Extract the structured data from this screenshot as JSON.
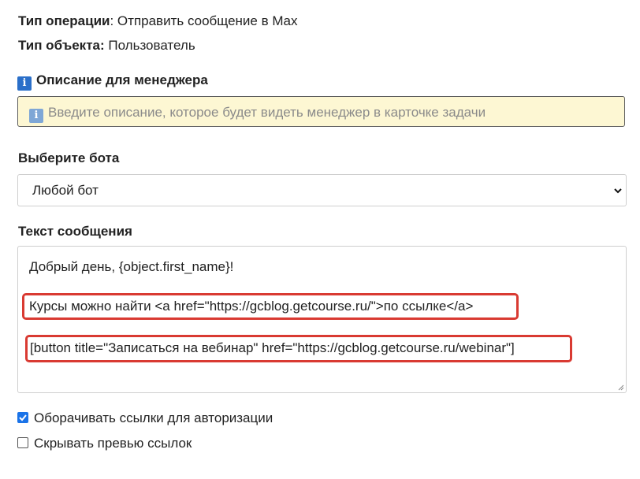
{
  "header": {
    "operation_label": "Тип операции",
    "operation_value": ": Отправить сообщение в Max",
    "object_label": "Тип объекта:",
    "object_value": " Пользователь"
  },
  "description": {
    "title": "Описание для менеджера",
    "placeholder": "Введите описание, которое будет видеть менеджер в карточке задачи"
  },
  "bot": {
    "label": "Выберите бота",
    "selected": "Любой бот"
  },
  "message": {
    "label": "Текст сообщения",
    "lines": [
      "Добрый день, {object.first_name}!",
      "Курсы можно найти <a href=\"https://gcblog.getcourse.ru/\">по ссылке</a>",
      "[button title=\"Записаться на вебинар\" href=\"https://gcblog.getcourse.ru/webinar\"]"
    ]
  },
  "options": {
    "wrap_links": {
      "label": "Оборачивать ссылки для авторизации",
      "checked": true
    },
    "hide_previews": {
      "label": "Скрывать превью ссылок",
      "checked": false
    }
  },
  "colors": {
    "accent": "#1a73e8",
    "highlight": "#d93a32",
    "info_bg": "#fdf7d3"
  },
  "icons": {
    "info": "info-icon",
    "dropdown": "chevron-down-icon"
  }
}
